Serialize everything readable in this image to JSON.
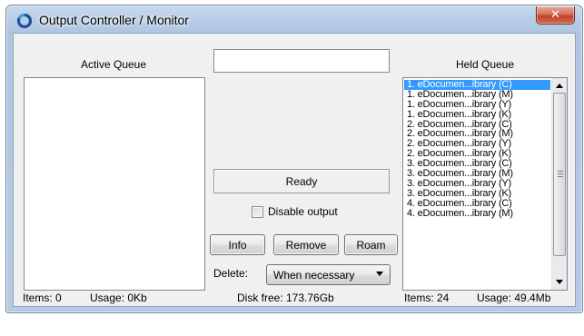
{
  "window": {
    "title": "Output Controller / Monitor",
    "close_glyph": "✕"
  },
  "active_queue": {
    "label": "Active Queue",
    "items_label": "Items: 0",
    "usage_label": "Usage: 0Kb"
  },
  "center": {
    "text_value": "",
    "status": "Ready",
    "disable_output_label": "Disable output",
    "disable_output_checked": false,
    "info_label": "Info",
    "remove_label": "Remove",
    "roam_label": "Roam",
    "delete_label": "Delete:",
    "delete_value": "When necessary",
    "disk_free_label": "Disk free:  173.76Gb"
  },
  "held_queue": {
    "label": "Held Queue",
    "items": [
      "1. eDocumen...ibrary (C)",
      "1. eDocumen...ibrary (M)",
      "1. eDocumen...ibrary (Y)",
      "1. eDocumen...ibrary (K)",
      "2. eDocumen...ibrary (C)",
      "2. eDocumen...ibrary (M)",
      "2. eDocumen...ibrary (Y)",
      "2. eDocumen...ibrary (K)",
      "3. eDocumen...ibrary (C)",
      "3. eDocumen...ibrary (M)",
      "3. eDocumen...ibrary (Y)",
      "3. eDocumen...ibrary (K)",
      "4. eDocumen...ibrary (C)",
      "4. eDocumen...ibrary (M)"
    ],
    "selected_index": 0,
    "items_label": "Items: 24",
    "usage_label": "Usage: 49.4Mb"
  },
  "colors": {
    "selection": "#3399ff",
    "close_button": "#c4432c",
    "title_bar": "#b9cee6"
  },
  "icons": {
    "app": "output-controller-icon",
    "close": "close-icon",
    "dropdown": "chevron-down-icon",
    "scroll_up": "scroll-up-icon",
    "scroll_down": "scroll-down-icon"
  }
}
